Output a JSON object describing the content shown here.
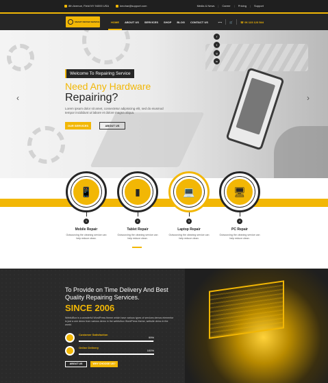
{
  "colors": {
    "accent": "#f2b705",
    "dark": "#262626"
  },
  "topbar": {
    "address": "8th Avenue, Field NY 94000 USA",
    "email": "kmohar@support.com",
    "links": [
      "Media & News",
      "Career",
      "Pricing",
      "Support"
    ]
  },
  "header": {
    "logo_text": "SMART REPAIR SERVICE",
    "nav": [
      "HOME",
      "ABOUT US",
      "SERVICES",
      "SHOP",
      "BLOG",
      "CONTACT US"
    ],
    "active_nav": "HOME",
    "phone": "06 123 123 544",
    "icons": [
      "share-icon",
      "cart-icon",
      "phone-icon"
    ]
  },
  "hero": {
    "welcome": "Welcome To Repairing Service",
    "line1": "Need Any Hardware",
    "line2": "Repairing?",
    "desc": "Lorem ipsum dolor sit amet, consectetur adipisicing elit, sed do eiusmod tempor incididunt ut labore et dolore magna aliqua.",
    "btn_services": "OUR SERVICES",
    "btn_about": "ABOUT US",
    "social": [
      "f",
      "t",
      "g",
      "in"
    ]
  },
  "services": [
    {
      "num": "1",
      "title": "Mobile Repair",
      "desc": "Outsourcing the cleaning service can help reduce clean.",
      "icon": "mobile-icon"
    },
    {
      "num": "2",
      "title": "Tablet Repair",
      "desc": "Outsourcing the cleaning service can help reduce clean.",
      "icon": "tablet-icon"
    },
    {
      "num": "3",
      "title": "Laptop Repair",
      "desc": "Outsourcing the cleaning service can help reduce clean.",
      "icon": "laptop-icon"
    },
    {
      "num": "4",
      "title": "PC Repair",
      "desc": "Outsourcing the cleaning service can help reduce clean.",
      "icon": "pc-icon"
    }
  ],
  "about": {
    "title": "To Provide on Time Delivery And Best Quality Repairing Services.",
    "since": "SINCE 2006",
    "desc": "WebfulBox is a wonderful WordPress theme which have various types of services demos elementor is just a one demo from various demo in the webfulbox WordPress theme, website demo in the world.",
    "stats": [
      {
        "label": "Customer Satisfaction",
        "value": 99
      },
      {
        "label": "Online Delivery",
        "value": 100
      }
    ],
    "btn_about": "ABOUT US",
    "btn_why": "WHY CHOOSE US?"
  }
}
